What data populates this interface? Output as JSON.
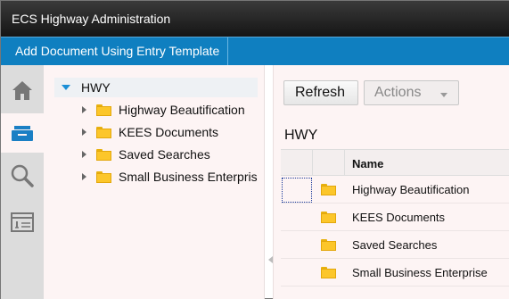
{
  "app": {
    "title": "ECS Highway Administration"
  },
  "command_bar": {
    "add_document_label": "Add Document Using Entry Template"
  },
  "launch_bar": {
    "items": [
      {
        "name": "home",
        "icon": "home-icon",
        "active": false
      },
      {
        "name": "browse",
        "icon": "folder-browse-icon",
        "active": true
      },
      {
        "name": "search",
        "icon": "search-icon",
        "active": false
      },
      {
        "name": "entry-templates",
        "icon": "form-template-icon",
        "active": false
      }
    ]
  },
  "tree": {
    "root_label": "HWY",
    "children": [
      {
        "label": "Highway Beautification"
      },
      {
        "label": "KEES Documents"
      },
      {
        "label": "Saved Searches"
      },
      {
        "label": "Small Business Enterpris"
      }
    ]
  },
  "toolbar": {
    "refresh_label": "Refresh",
    "actions_label": "Actions"
  },
  "content": {
    "folder_title": "HWY",
    "columns": {
      "name": "Name"
    },
    "rows": [
      {
        "name": "Highway Beautification"
      },
      {
        "name": "KEES Documents"
      },
      {
        "name": "Saved Searches"
      },
      {
        "name": "Small Business Enterprise"
      }
    ]
  },
  "colors": {
    "titlebar": "#1f1f1f",
    "command_bar": "#0f7fc0",
    "accent_arrow": "#1a8fd6",
    "folder": "#fcc62a",
    "pane_bg": "#fdf4f4"
  }
}
